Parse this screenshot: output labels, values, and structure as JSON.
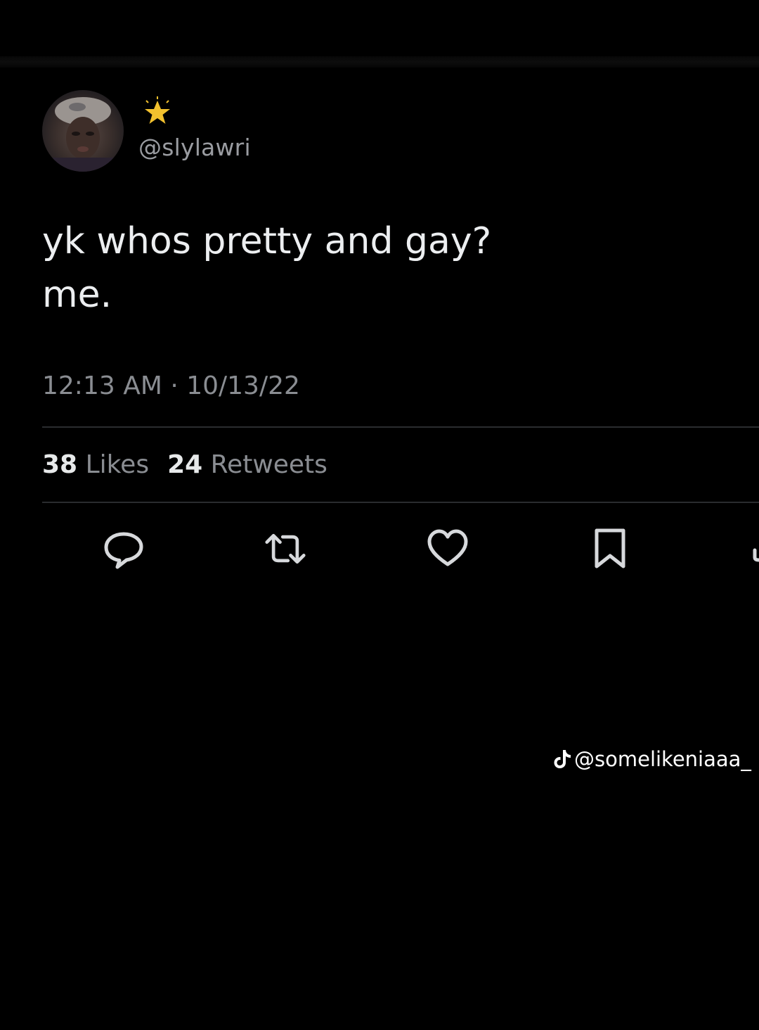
{
  "tweet": {
    "handle": "@slylawri",
    "text_lines": [
      "yk whos pretty and gay?",
      "me."
    ],
    "timestamp": "12:13 AM · 10/13/22",
    "stats": {
      "likes_count": "38",
      "likes_label": "Likes",
      "retweets_count": "24",
      "retweets_label": "Retweets"
    },
    "actions": [
      "reply-icon",
      "retweet-icon",
      "like-icon",
      "bookmark-icon",
      "share-icon"
    ]
  },
  "watermark": {
    "icon": "tiktok-icon",
    "text": "@somelikeniaaa_"
  },
  "colors": {
    "background": "#000000",
    "text_primary": "#eceef0",
    "text_secondary": "#8a8d92",
    "divider": "#2a2c2f",
    "badge": "#f2c12e"
  }
}
